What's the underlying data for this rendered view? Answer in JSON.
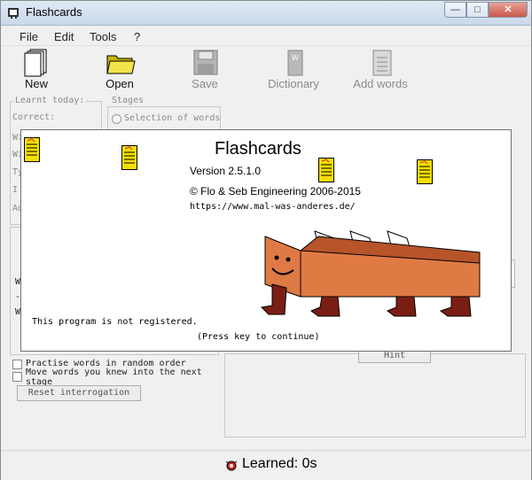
{
  "window": {
    "title": "Flashcards",
    "minimize": "—",
    "maximize": "□",
    "close": "✕"
  },
  "menu": [
    "File",
    "Edit",
    "Tools",
    "?"
  ],
  "toolbar": [
    {
      "label": "New",
      "icon": "new-document-icon",
      "enabled": true
    },
    {
      "label": "Open",
      "icon": "folder-open-icon",
      "enabled": true
    },
    {
      "label": "Save",
      "icon": "floppy-disk-icon",
      "enabled": false
    },
    {
      "label": "Dictionary",
      "icon": "dictionary-book-icon",
      "enabled": false
    },
    {
      "label": "Add words",
      "icon": "add-words-document-icon",
      "enabled": false
    }
  ],
  "left_panel": {
    "learnt_today_title": "Learnt today:",
    "correct_label": "Correct:",
    "row_prefixes": [
      "Wi",
      "Wi",
      "Ty",
      "I ",
      "Ad"
    ],
    "lower_prefixes": [
      "W",
      "-I",
      "W"
    ]
  },
  "stages": {
    "title": "Stages",
    "selection_label": "Selection of words"
  },
  "options": {
    "random_order": "Practise words in random order",
    "move_words": "Move words you knew into the next stage",
    "reset_button": "Reset interrogation",
    "hint_button": "Hint"
  },
  "splash": {
    "title": "Flashcards",
    "version": "Version 2.5.1.0",
    "copyright": "© Flo & Seb Engineering 2006-2015",
    "url": "https://www.mal-was-anderes.de/",
    "registration": "This program is not registered.",
    "continue": "(Press key to continue)"
  },
  "status": {
    "text": "Learned: 0s",
    "icon": "bug-icon"
  },
  "colors": {
    "note_yellow": "#f5e000",
    "box_orange": "#e07a45",
    "leg_red": "#7a1e14"
  }
}
